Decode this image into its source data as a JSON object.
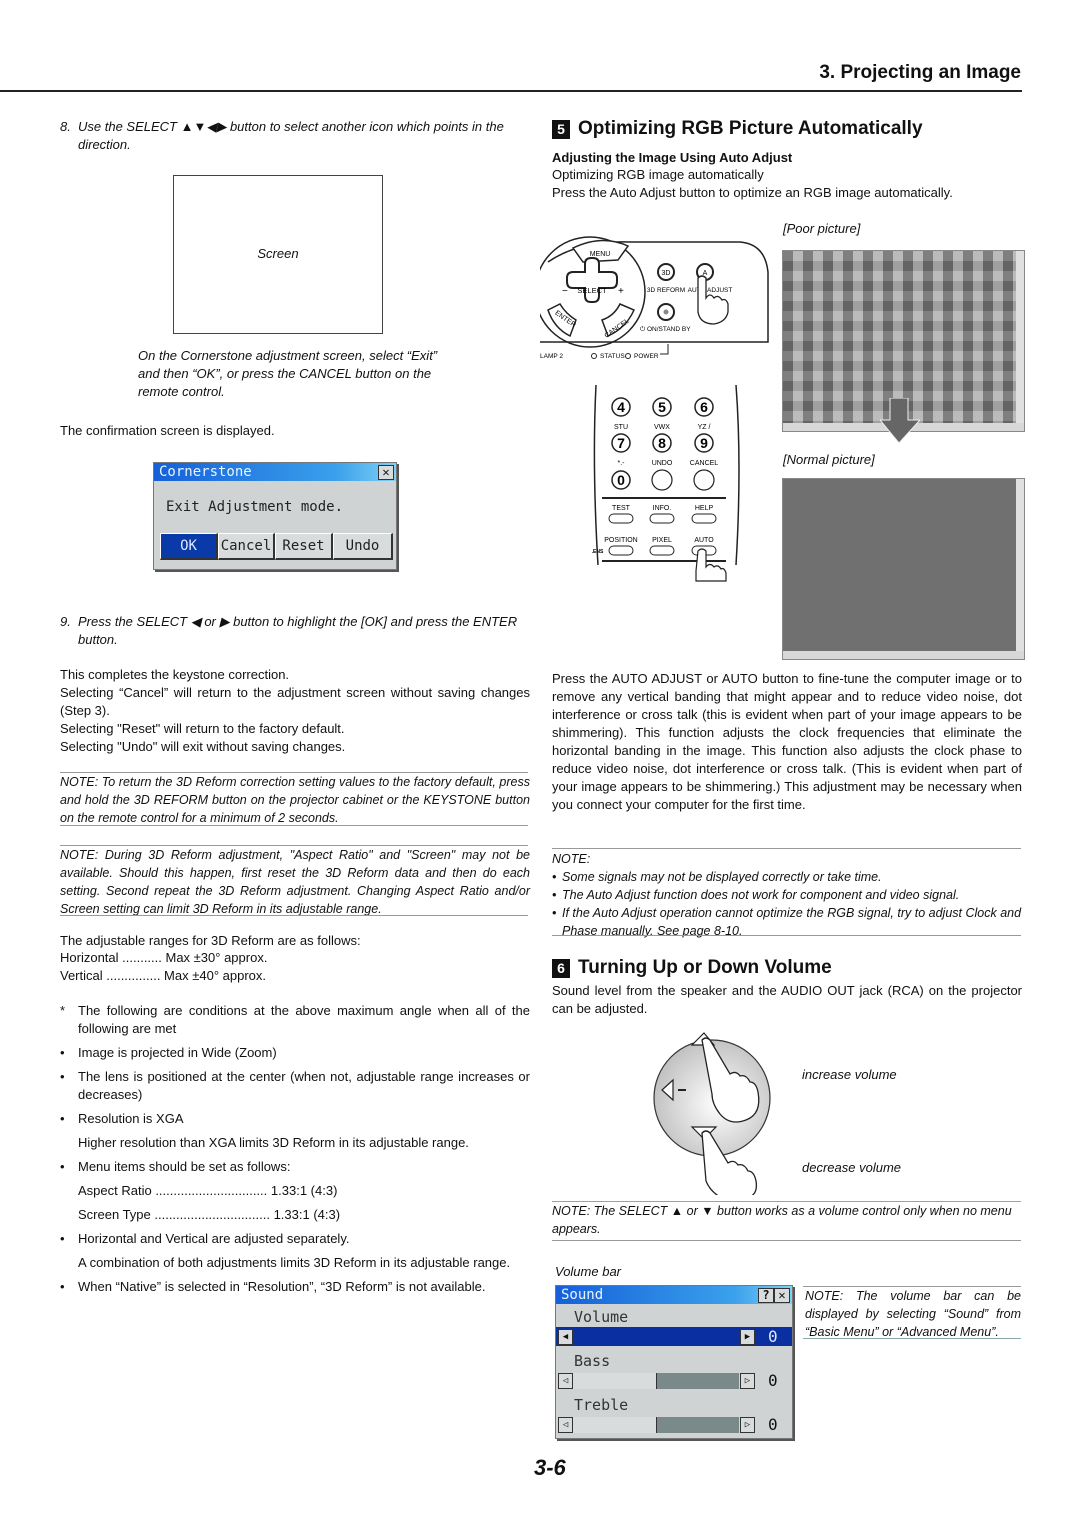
{
  "header": {
    "chapter_title": "3. Projecting an Image"
  },
  "left": {
    "step8": {
      "num": "8.",
      "text": "Use the SELECT ▲▼◀▶ button to select another icon which points in the direction."
    },
    "screen_label": "Screen",
    "screen_caption": "On the Cornerstone adjustment screen, select “Exit” and then “OK”, or press the CANCEL button on the remote control.",
    "confirm_text": "The confirmation screen is displayed.",
    "cornerstone_dialog": {
      "title": "Cornerstone",
      "message": "Exit Adjustment mode.",
      "buttons": [
        "OK",
        "Cancel",
        "Reset",
        "Undo"
      ],
      "selected": "OK",
      "close_glyph": "✕"
    },
    "step9": {
      "num": "9.",
      "text": "Press the SELECT ◀ or ▶ button to highlight the [OK] and press the ENTER button."
    },
    "completion_lines": [
      "This completes the keystone correction.",
      "Selecting “Cancel” will return to the adjustment screen without saving changes (Step 3).",
      "Selecting \"Reset\" will return to the factory default.",
      "Selecting \"Undo\" will exit without saving changes."
    ],
    "note1": "NOTE: To return the 3D Reform correction setting values to the factory default, press and hold the 3D REFORM button on the projector cabinet or the KEYSTONE button on the remote control for a minimum of 2 seconds.",
    "note2": "NOTE: During 3D Reform adjustment, \"Aspect Ratio\" and \"Screen\" may not be available. Should this happen, first reset the 3D Reform data and then do each setting. Second repeat the 3D Reform adjustment. Changing Aspect Ratio and/or Screen setting can limit 3D Reform in its adjustable range.",
    "ranges_intro": "The adjustable ranges for 3D Reform are as follows:",
    "ranges": [
      {
        "label": "Horizontal",
        "dots": " ........... ",
        "value": "Max ±30° approx."
      },
      {
        "label": "Vertical",
        "dots": " ............... ",
        "value": "Max ±40° approx."
      }
    ],
    "conditions_intro": "The following are conditions at the above maximum angle when all of the following are met",
    "bullets": [
      "Image is projected in Wide (Zoom)",
      "The lens is positioned at the center (when not, adjustable range increases or decreases)",
      "Resolution is XGA",
      "Menu items should be set as follows:",
      "Horizontal and Vertical are adjusted separately.",
      "When “Native” is selected in “Resolution”, “3D Reform” is not available."
    ],
    "xga_sub": "Higher resolution than XGA limits 3D Reform in its adjustable range.",
    "menu_settings": [
      {
        "label": "Aspect Ratio",
        "dots": " ............................... ",
        "value": "1.33:1 (4:3)"
      },
      {
        "label": "Screen Type",
        "dots": " ................................ ",
        "value": "1.33:1 (4:3)"
      }
    ],
    "combo_sub": "A combination of both adjustments limits 3D Reform in its adjustable range.",
    "asterisk": "*",
    "bullet": "•"
  },
  "right": {
    "section5": {
      "num": "5",
      "title": "Optimizing RGB Picture Automatically",
      "subhead": "Adjusting the Image Using Auto Adjust",
      "line1": "Optimizing RGB image automatically",
      "line2": "Press the Auto Adjust button to optimize an RGB image automatically.",
      "poor_label": "[Poor picture]",
      "normal_label": "[Normal picture]",
      "panel": {
        "menu": "MENU",
        "select": "SELECT",
        "minus": "−",
        "plus": "+",
        "enter": "ENTER",
        "cancel": "CANCEL",
        "reform_btn": "3D",
        "reform_label": "3D REFORM",
        "auto_btn": "A",
        "auto_label": "AUTO ADJUST",
        "power_label": "⏻ ON/STAND BY",
        "indicators": [
          "LAMP 2",
          "STATUS",
          "POWER"
        ]
      },
      "remote": {
        "row1": [
          "4",
          "5",
          "6"
        ],
        "labels2": [
          "STU",
          "VWX",
          "YZ /"
        ],
        "row2": [
          "7",
          "8",
          "9"
        ],
        "labels3": [
          "*.-",
          "UNDO",
          "CANCEL"
        ],
        "row3_key": "0",
        "row4": [
          "TEST",
          "INFO.",
          "HELP"
        ],
        "row5": [
          "POSITION",
          "PIXEL",
          "AUTO"
        ],
        "lens": "LENS"
      },
      "body": "Press the AUTO ADJUST or AUTO button to fine-tune the computer image or to remove any vertical banding that might appear and to reduce video noise, dot interference or cross talk (this is evident when part of your image appears to be shimmering). This function adjusts the clock frequencies that eliminate the horizontal banding in the image. This function also adjusts the clock phase to reduce video noise, dot interference or cross talk. (This is evident when part of your image appears to be shimmering.) This adjustment may be necessary when you connect your computer for the first time.",
      "note_head": "NOTE:",
      "notes": [
        "Some signals may not be displayed correctly or take time.",
        "The Auto Adjust function does not work for component and video signal.",
        "If the Auto Adjust operation cannot optimize the RGB signal, try to adjust Clock and Phase manually. See page 8-10."
      ]
    },
    "section6": {
      "num": "6",
      "title": "Turning Up or Down Volume",
      "body": "Sound level from the speaker and the AUDIO OUT jack (RCA) on the projector can be adjusted.",
      "increase": "increase volume",
      "decrease": "decrease volume",
      "note": "NOTE: The SELECT ▲ or ▼ button works as a volume control only when no menu appears.",
      "volume_bar_label": "Volume bar",
      "sound_dialog": {
        "title": "Sound",
        "help_glyph": "?",
        "close_glyph": "✕",
        "rows": [
          {
            "label": "Volume",
            "value": "0",
            "level": 0.5,
            "selected": true
          },
          {
            "label": "Bass",
            "value": "0",
            "level": 0.5,
            "selected": false
          },
          {
            "label": "Treble",
            "value": "0",
            "level": 0.5,
            "selected": false
          }
        ]
      },
      "side_note": "NOTE: The volume bar can be displayed by selecting “Sound” from “Basic Menu” or “Advanced Menu”."
    }
  },
  "footer": {
    "page_number": "3-6"
  }
}
